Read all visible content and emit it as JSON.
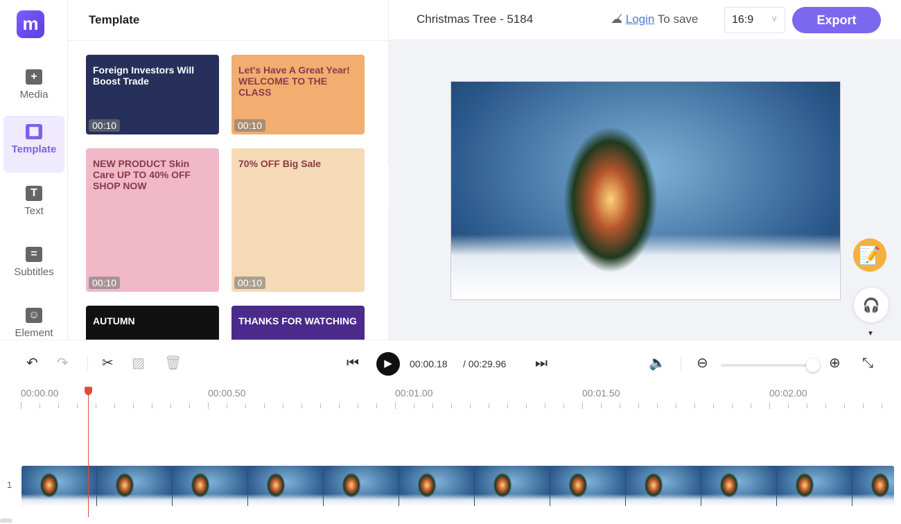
{
  "app": {
    "logo_text": "m"
  },
  "sidebar": {
    "items": [
      {
        "label": "Media",
        "icon": "media-add-icon",
        "glyph": "+"
      },
      {
        "label": "Template",
        "icon": "template-icon",
        "glyph": "▦",
        "active": true
      },
      {
        "label": "Text",
        "icon": "text-icon",
        "glyph": "T"
      },
      {
        "label": "Subtitles",
        "icon": "subtitles-icon",
        "glyph": "="
      },
      {
        "label": "Element",
        "icon": "element-icon",
        "glyph": "☺"
      }
    ]
  },
  "panel": {
    "title": "Template",
    "templates": [
      {
        "name": "Foreign Investors Will Boost Trade",
        "text": "Foreign Investors Will Boost Trade",
        "duration": "00:10",
        "bg": "#26305a"
      },
      {
        "name": "Welcome to the class",
        "text": "Let's Have A Great Year! WELCOME TO THE CLASS",
        "duration": "00:10",
        "bg": "#f2ad70"
      },
      {
        "name": "Skin Care",
        "text": "NEW PRODUCT Skin Care  UP TO 40% OFF  SHOP NOW",
        "duration": "00:10",
        "bg": "#f1b8c8"
      },
      {
        "name": "Big Sale",
        "text": "70% OFF  Big Sale",
        "duration": "00:10",
        "bg": "#f6d9b5"
      },
      {
        "name": "Autumn",
        "text": "AUTUMN",
        "duration": "",
        "bg": "#111111"
      },
      {
        "name": "Thanks for watching",
        "text": "THANKS FOR WATCHING",
        "duration": "",
        "bg": "#4a2a8a"
      }
    ]
  },
  "header": {
    "project_title": "Christmas Tree - 5184",
    "login_link": "Login",
    "login_suffix": "To save",
    "aspect_ratio": "16:9",
    "export_label": "Export",
    "accent": "#7b68ee"
  },
  "playback": {
    "current_time": "00:00.18",
    "total_time": "/ 00:29.96",
    "zoom_level_percent": 95
  },
  "ruler": {
    "labels": [
      "00:00.00",
      "00:00.50",
      "00:01.00",
      "00:01.50",
      "00:02.00"
    ]
  },
  "track": {
    "number": "1",
    "frame_count": 12
  }
}
